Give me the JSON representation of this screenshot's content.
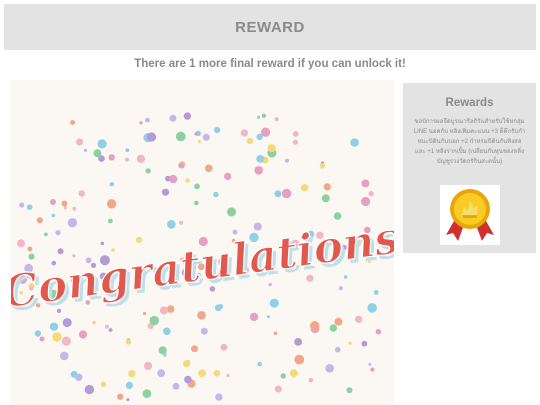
{
  "header": {
    "title": "REWARD"
  },
  "main": {
    "subtitle": "There are 1 more final reward if you can unlock it!",
    "image_text": "Congratulations"
  },
  "sidebar": {
    "title": "Rewards",
    "description": "ขอบัการผลจึดบูรณาริลกิรัแสำหรับใช้หกลุ่ม LINE นอคกับ หลิงเพิ่มคะแนน +3 ต็คึกรับกำหนะบิตินกันบอก +2 กำหรมบิตินกันหิงสอ และ +1 หลิงรากเปิ้ม (เปลี่ยนกับหุนชองหลิ่งบัญชูรวงวัดกรักินสะดนั้น)",
    "medal_icon": "gold-medal-icon"
  },
  "colors": {
    "header_bg": "#e3e3e3",
    "text_gray": "#8a8a8a",
    "lettering": "#e0594c"
  }
}
